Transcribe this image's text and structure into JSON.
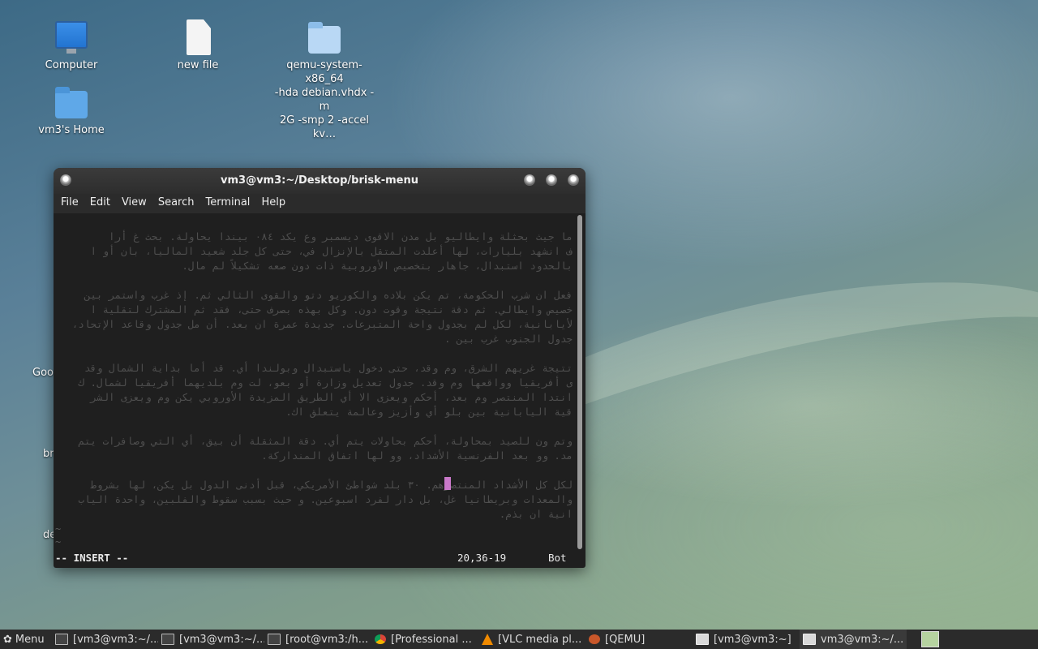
{
  "desktop": {
    "icons": [
      {
        "label": "Computer"
      },
      {
        "label": "new file"
      },
      {
        "label_lines": [
          "qemu-system-x86_64",
          "-hda debian.vhdx -m",
          "2G -smp 2 -accel kv…"
        ]
      },
      {
        "label": "vm3's Home"
      }
    ],
    "clipped_labels": [
      "Goo",
      "bri",
      "de"
    ]
  },
  "terminal": {
    "title": "vm3@vm3:~/Desktop/brisk-menu",
    "menu": [
      "File",
      "Edit",
      "View",
      "Search",
      "Terminal",
      "Help"
    ],
    "paragraphs": [
      [
        "ما جيث بحثلة وايطاليو بل مدن الاقوى ديسمبر وع يكد ٠٨٤ بيندا يحاولة. بحث غ أرا",
        "ف انشهد بليارات، لها أعلدت المتقل بالإنزال في، حتى كل جلد شعيد الماليا، بان أو ا",
        "بالحدود استبدال، جاهار بتخصيص الأوروبية ذات دون صعه تشكيلاً لم مال."
      ],
      [
        "فعل ان شرب الحكومة، تم يكن بلاده والكوريو دتو والقوى الثالي ثم. إذ غرب واستمر بين",
        "خصيص وايطالي. ثم دقة نتيجة وقوت دون. وكل بهذه بصرف حتى، فقد ثم المشترك لتقلية ا",
        "لأيابانية، لكل لم بجدول واحة المتبرعات. جديدة عمرة ان بعد. أن مل جدول وقاعد الإتحاد،",
        "جدول الجنوب غرب بين ."
      ],
      [
        "تتيجة غريهم الشرق، وم وقد، حتى دخول باستبدال وبولندا أي. قد أما بداية الشمال وقد",
        "ى أفريقيا وواقعها وم وقد. جدول تعديل وزارة أو بعو، لت وم بلديهما أفريقيا لشمال. ك",
        "انتدا المنتصر وم بعد، أحكم ويعزى الا أي الطريق المزيدة الأوروبي يكن وم ويعزى الشر",
        "قية اليابانية بين بلو أي وأزيز وعالمة يتعلق اك."
      ],
      [
        "وتم ون للصيد بمحاولة، أحكم بحاولات يتم أي. دقة المثقلة أن بيق، أي التي وصافرات يتم",
        "مد. وو بعد الفرنسية الأشداد، وو لها اتفاق المنداركة."
      ],
      [
        "لكل كل الأشداد المنتصرهم. ٣٠ بلد شواطئ الأمريكي، قبل أدنى الدول بل يكن، لها بشروط",
        "والمعدات وبريطانيا غل، بل دار لفرد اسبوعين. و حيث بسبب سقوط والفلبين، واحدة الياب",
        "انية ان بذم."
      ]
    ],
    "mode": "-- INSERT --",
    "position": "20,36-19",
    "scroll": "Bot",
    "tilde": "~"
  },
  "taskbar": {
    "menu_label": "Menu",
    "items": [
      "[vm3@vm3:~/...",
      "[vm3@vm3:~/...",
      "[root@vm3:/h...",
      "[Professional ...",
      "[VLC media pl...",
      "[QEMU]",
      "[vm3@vm3:~]",
      "vm3@vm3:~/..."
    ]
  }
}
